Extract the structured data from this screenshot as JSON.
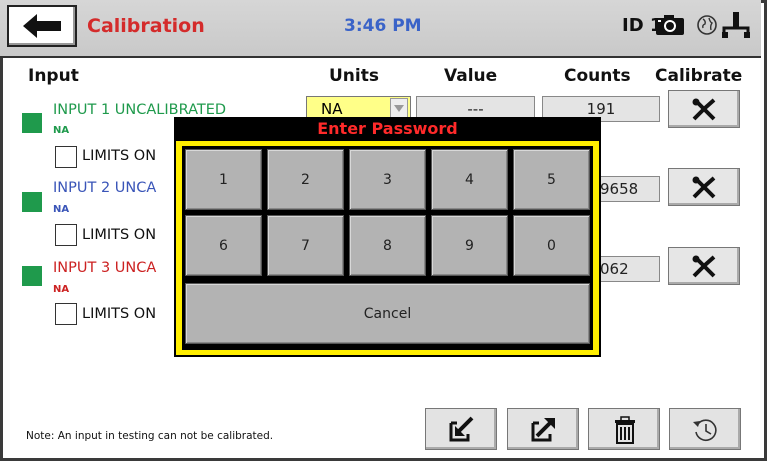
{
  "header": {
    "title": "Calibration",
    "time": "3:46 PM",
    "device_id": "ID 1",
    "icons": [
      "back-arrow-icon",
      "camera-icon",
      "globe-icon",
      "usb-icon"
    ]
  },
  "table": {
    "columns": [
      "Input",
      "Units",
      "Value",
      "Counts",
      "Calibrate"
    ],
    "rows": [
      {
        "name": "INPUT 1 UNCALIBRATED",
        "unit_short": "NA",
        "limits_label": "LIMITS ON",
        "units": "NA",
        "value": "---",
        "counts": "191",
        "color": "#1f9a4c"
      },
      {
        "name": "INPUT 2 UNCA",
        "unit_short": "NA",
        "limits_label": "LIMITS ON",
        "counts": "9658",
        "color": "#3a55b8"
      },
      {
        "name": "INPUT 3 UNCA",
        "unit_short": "NA",
        "limits_label": "LIMITS ON",
        "counts": "062",
        "color": "#cc2222"
      }
    ]
  },
  "note": "Note:  An input in testing can not be calibrated.",
  "dialog": {
    "title": "Enter Password",
    "keys": [
      "1",
      "2",
      "3",
      "4",
      "5",
      "6",
      "7",
      "8",
      "9",
      "0"
    ],
    "cancel_label": "Cancel"
  },
  "colors": {
    "title_red": "#d42b2b",
    "time_blue": "#3a63c8",
    "status_green": "#1f9a4c",
    "dialog_border": "#ffee00",
    "units_yellow": "#ffff88"
  }
}
